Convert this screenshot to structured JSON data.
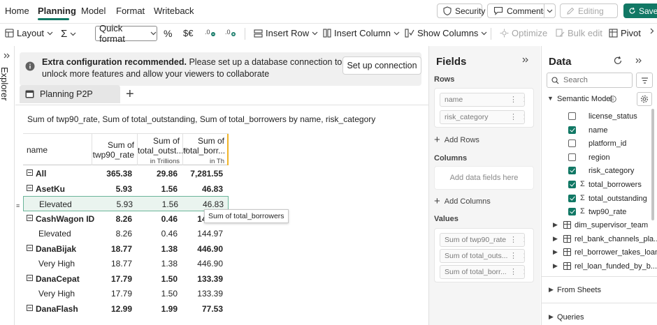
{
  "menu": {
    "items": [
      {
        "label": "Home",
        "active": false
      },
      {
        "label": "Planning",
        "active": true
      },
      {
        "label": "Model",
        "active": false
      },
      {
        "label": "Format",
        "active": false
      },
      {
        "label": "Writeback",
        "active": false
      }
    ],
    "security_label": "Security",
    "comments_label": "Comments",
    "editing_label": "Editing",
    "save_label": "Save"
  },
  "toolbar": {
    "layout_label": "Layout",
    "sum_symbol": "Σ",
    "quick_format_label": "Quick format",
    "percent_symbol": "%",
    "currency_symbol": "$€",
    "insert_row_label": "Insert Row",
    "insert_column_label": "Insert Column",
    "show_columns_label": "Show Columns",
    "optimize_label": "Optimize",
    "bulk_edit_label": "Bulk edit",
    "pivot_label": "Pivot"
  },
  "explorer": {
    "label": "Explorer"
  },
  "banner": {
    "bold_text": "Extra configuration recommended.",
    "text": " Please set up a database connection to unlock more features and allow your viewers to collaborate",
    "button_label": "Set up connection"
  },
  "sheet": {
    "tab_label": "Planning P2P",
    "add_symbol": "+"
  },
  "viz": {
    "title": "Sum of twp90_rate, Sum of total_outstanding, Sum of total_borrowers by name, risk_category",
    "headers": {
      "name": "name",
      "col1": "Sum of twp90_rate",
      "col2": "Sum of total_outst...",
      "col2_sub": "in Trillions",
      "col3": "Sum of total_borr...",
      "col3_sub": "in Th"
    },
    "tooltip": "Sum of total_borrowers",
    "rows": [
      {
        "label": "All",
        "level": 0,
        "v1": "365.38",
        "v2": "29.86",
        "v3": "7,281.55"
      },
      {
        "label": "AsetKu",
        "level": 0,
        "v1": "5.93",
        "v2": "1.56",
        "v3": "46.83"
      },
      {
        "label": "Elevated",
        "level": 1,
        "v1": "5.93",
        "v2": "1.56",
        "v3": "46.83",
        "selected": true
      },
      {
        "label": "CashWagon ID",
        "level": 0,
        "v1": "8.26",
        "v2": "0.46",
        "v3": "144.97"
      },
      {
        "label": "Elevated",
        "level": 1,
        "v1": "8.26",
        "v2": "0.46",
        "v3": "144.97"
      },
      {
        "label": "DanaBijak",
        "level": 0,
        "v1": "18.77",
        "v2": "1.38",
        "v3": "446.90"
      },
      {
        "label": "Very High",
        "level": 1,
        "v1": "18.77",
        "v2": "1.38",
        "v3": "446.90"
      },
      {
        "label": "DanaCepat",
        "level": 0,
        "v1": "17.79",
        "v2": "1.50",
        "v3": "133.39"
      },
      {
        "label": "Very High",
        "level": 1,
        "v1": "17.79",
        "v2": "1.50",
        "v3": "133.39"
      },
      {
        "label": "DanaFlash",
        "level": 0,
        "v1": "12.99",
        "v2": "1.99",
        "v3": "77.53"
      }
    ]
  },
  "fields": {
    "title": "Fields",
    "rows_label": "Rows",
    "rows_chips": [
      "name",
      "risk_category"
    ],
    "add_rows": "Add Rows",
    "columns_label": "Columns",
    "columns_placeholder": "Add data fields here",
    "add_columns": "Add Columns",
    "values_label": "Values",
    "values_chips": [
      "Sum of twp90_rate",
      "Sum of total_outs...",
      "Sum of total_borr..."
    ]
  },
  "data": {
    "title": "Data",
    "search_placeholder": "Search",
    "semantic_model_label": "Semantic Model",
    "fields": [
      {
        "label": "license_status",
        "checked": false,
        "sigma": false
      },
      {
        "label": "name",
        "checked": true,
        "sigma": false
      },
      {
        "label": "platform_id",
        "checked": false,
        "sigma": false
      },
      {
        "label": "region",
        "checked": false,
        "sigma": false
      },
      {
        "label": "risk_category",
        "checked": true,
        "sigma": false
      },
      {
        "label": "total_borrowers",
        "checked": true,
        "sigma": true
      },
      {
        "label": "total_outstanding",
        "checked": true,
        "sigma": true
      },
      {
        "label": "twp90_rate",
        "checked": true,
        "sigma": true
      }
    ],
    "tables": [
      "dim_supervisor_team",
      "rel_bank_channels_pla...",
      "rel_borrower_takes_loan",
      "rel_loan_funded_by_b..."
    ],
    "from_sheets_label": "From Sheets",
    "queries_label": "Queries"
  },
  "colors": {
    "accent": "#117865",
    "banner_bg": "#f0f0f0",
    "selected_row": "#eaf4ef"
  }
}
